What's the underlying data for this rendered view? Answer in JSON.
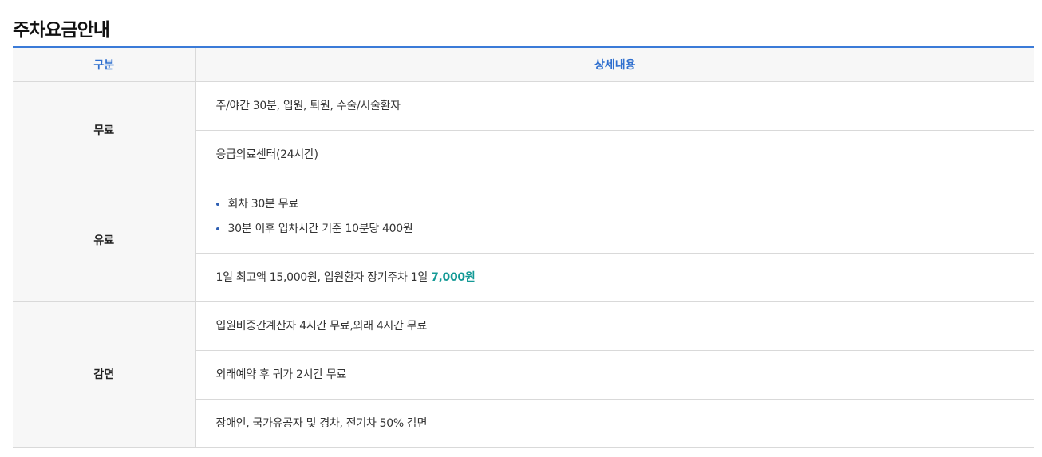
{
  "page": {
    "title": "주차요금안내"
  },
  "table": {
    "headers": {
      "category": "구분",
      "detail": "상세내용"
    },
    "free": {
      "category": "무료",
      "rows": [
        "주/야간 30분, 입원, 퇴원, 수술/시술환자",
        "응급의료센터(24시간)"
      ]
    },
    "paid": {
      "category": "유료",
      "bullets": [
        "회차 30분 무료",
        "30분 이후 입차시간 기준 10분당 400원"
      ],
      "max_text": "1일 최고액 15,000원, 입원환자 장기주차 1일 ",
      "max_highlight": "7,000원"
    },
    "discount": {
      "category": "감면",
      "rows": [
        "입원비중간계산자 4시간 무료,외래 4시간 무료",
        "외래예약 후 귀가 2시간 무료",
        "장애인, 국가유공자 및 경차, 전기차 50% 감면"
      ]
    }
  },
  "colors": {
    "accent": "#3b7bd8",
    "header_text": "#2f6fcf",
    "highlight": "#149a96",
    "bullet": "#2f5fb3"
  }
}
